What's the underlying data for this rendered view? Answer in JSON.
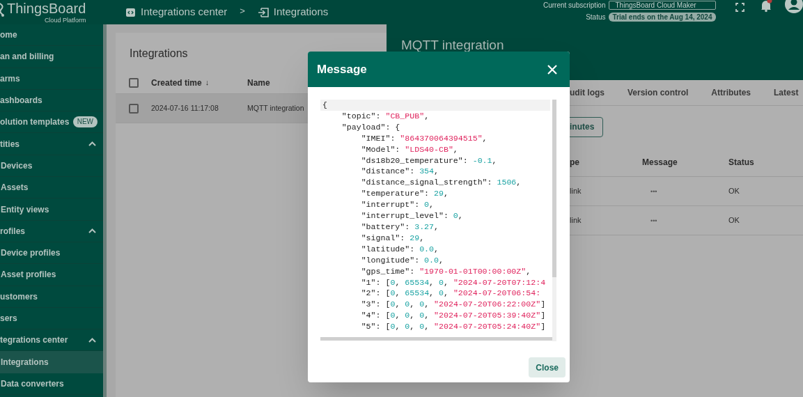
{
  "header": {
    "logo_title": "ThingsBoard",
    "logo_subtitle": "Cloud Platform",
    "breadcrumbs": [
      "Integrations center",
      "Integrations"
    ],
    "breadcrumb_separator": ">",
    "subscription_label": "Current subscription",
    "subscription_value": "ThingsBoard Cloud Maker",
    "status_label": "Status",
    "status_value": "Trial ends on the Aug 14, 2024"
  },
  "sidebar": {
    "items": [
      {
        "kind": "item",
        "label": "ome",
        "selected": false
      },
      {
        "kind": "item",
        "label": "an and billing",
        "selected": false
      },
      {
        "kind": "item",
        "label": "arms",
        "selected": false
      },
      {
        "kind": "item",
        "label": "ashboards",
        "selected": false
      },
      {
        "kind": "item",
        "label": "olution templates",
        "badge": "NEW",
        "selected": false
      },
      {
        "kind": "section",
        "label": "tities",
        "expanded": true,
        "children": [
          {
            "label": "Devices",
            "selected": false
          },
          {
            "label": "Assets",
            "selected": false
          },
          {
            "label": "Entity views",
            "selected": false
          }
        ]
      },
      {
        "kind": "section",
        "label": "rofiles",
        "expanded": true,
        "children": [
          {
            "label": "Device profiles",
            "selected": false
          },
          {
            "label": "Asset profiles",
            "selected": false
          }
        ]
      },
      {
        "kind": "item",
        "label": "ustomers",
        "selected": false
      },
      {
        "kind": "item",
        "label": "sers",
        "selected": false
      },
      {
        "kind": "section",
        "label": "tegrations center",
        "expanded": true,
        "children": [
          {
            "label": "Integrations",
            "selected": true
          },
          {
            "label": "Data converters",
            "selected": false
          }
        ]
      }
    ]
  },
  "integrations_card": {
    "title": "Integrations",
    "all_checked": false,
    "columns": [
      "Created time",
      "Name"
    ],
    "sort_arrow": "↓",
    "rows": [
      {
        "created_time": "2024-07-16 11:17:08",
        "name": "MQTT integration",
        "checked": false,
        "selected": true
      }
    ]
  },
  "details_panel": {
    "title": "MQTT integration",
    "tabs": [
      "udit logs",
      "Version control",
      "Attributes",
      "Latest"
    ],
    "time_button": "inutes",
    "columns": [
      "pe",
      "Message",
      "Status"
    ],
    "rows": [
      {
        "type": "link",
        "message": "•••",
        "status": "OK"
      },
      {
        "type": "link",
        "message": "•••",
        "status": "OK"
      }
    ]
  },
  "dialog": {
    "title": "Message",
    "close_button": "Close",
    "code_lines": [
      {
        "highlighted": true,
        "tokens": [
          {
            "kind": "plain",
            "text": "{"
          }
        ]
      },
      {
        "highlighted": false,
        "tokens": [
          {
            "kind": "plain",
            "text": "    \"topic\": "
          },
          {
            "kind": "string",
            "text": "\"CB_PUB\""
          },
          {
            "kind": "plain",
            "text": ","
          }
        ]
      },
      {
        "highlighted": false,
        "tokens": [
          {
            "kind": "plain",
            "text": "    \"payload\": {"
          }
        ]
      },
      {
        "highlighted": false,
        "tokens": [
          {
            "kind": "plain",
            "text": "        \"IMEI\": "
          },
          {
            "kind": "string",
            "text": "\"864370064394515\""
          },
          {
            "kind": "plain",
            "text": ","
          }
        ]
      },
      {
        "highlighted": false,
        "tokens": [
          {
            "kind": "plain",
            "text": "        \"Model\": "
          },
          {
            "kind": "string",
            "text": "\"LDS40-CB\""
          },
          {
            "kind": "plain",
            "text": ","
          }
        ]
      },
      {
        "highlighted": false,
        "tokens": [
          {
            "kind": "plain",
            "text": "        \"ds18b20_temperature\": "
          },
          {
            "kind": "number",
            "text": "-0.1"
          },
          {
            "kind": "plain",
            "text": ","
          }
        ]
      },
      {
        "highlighted": false,
        "tokens": [
          {
            "kind": "plain",
            "text": "        \"distance\": "
          },
          {
            "kind": "number",
            "text": "354"
          },
          {
            "kind": "plain",
            "text": ","
          }
        ]
      },
      {
        "highlighted": false,
        "tokens": [
          {
            "kind": "plain",
            "text": "        \"distance_signal_strength\": "
          },
          {
            "kind": "number",
            "text": "1506"
          },
          {
            "kind": "plain",
            "text": ","
          }
        ]
      },
      {
        "highlighted": false,
        "tokens": [
          {
            "kind": "plain",
            "text": "        \"temperature\": "
          },
          {
            "kind": "number",
            "text": "29"
          },
          {
            "kind": "plain",
            "text": ","
          }
        ]
      },
      {
        "highlighted": false,
        "tokens": [
          {
            "kind": "plain",
            "text": "        \"interrupt\": "
          },
          {
            "kind": "number",
            "text": "0"
          },
          {
            "kind": "plain",
            "text": ","
          }
        ]
      },
      {
        "highlighted": false,
        "tokens": [
          {
            "kind": "plain",
            "text": "        \"interrupt_level\": "
          },
          {
            "kind": "number",
            "text": "0"
          },
          {
            "kind": "plain",
            "text": ","
          }
        ]
      },
      {
        "highlighted": false,
        "tokens": [
          {
            "kind": "plain",
            "text": "        \"battery\": "
          },
          {
            "kind": "number",
            "text": "3.27"
          },
          {
            "kind": "plain",
            "text": ","
          }
        ]
      },
      {
        "highlighted": false,
        "tokens": [
          {
            "kind": "plain",
            "text": "        \"signal\": "
          },
          {
            "kind": "number",
            "text": "29"
          },
          {
            "kind": "plain",
            "text": ","
          }
        ]
      },
      {
        "highlighted": false,
        "tokens": [
          {
            "kind": "plain",
            "text": "        \"latitude\": "
          },
          {
            "kind": "number",
            "text": "0.0"
          },
          {
            "kind": "plain",
            "text": ","
          }
        ]
      },
      {
        "highlighted": false,
        "tokens": [
          {
            "kind": "plain",
            "text": "        \"longitude\": "
          },
          {
            "kind": "number",
            "text": "0.0"
          },
          {
            "kind": "plain",
            "text": ","
          }
        ]
      },
      {
        "highlighted": false,
        "tokens": [
          {
            "kind": "plain",
            "text": "        \"gps_time\": "
          },
          {
            "kind": "string",
            "text": "\"1970-01-01T00:00:00Z\""
          },
          {
            "kind": "plain",
            "text": ","
          }
        ]
      },
      {
        "highlighted": false,
        "tokens": [
          {
            "kind": "plain",
            "text": "        \"1\": ["
          },
          {
            "kind": "number",
            "text": "0"
          },
          {
            "kind": "plain",
            "text": ", "
          },
          {
            "kind": "number",
            "text": "65534"
          },
          {
            "kind": "plain",
            "text": ", "
          },
          {
            "kind": "number",
            "text": "0"
          },
          {
            "kind": "plain",
            "text": ", "
          },
          {
            "kind": "string",
            "text": "\"2024-07-20T07:12:4"
          }
        ]
      },
      {
        "highlighted": false,
        "tokens": [
          {
            "kind": "plain",
            "text": "        \"2\": ["
          },
          {
            "kind": "number",
            "text": "0"
          },
          {
            "kind": "plain",
            "text": ", "
          },
          {
            "kind": "number",
            "text": "65534"
          },
          {
            "kind": "plain",
            "text": ", "
          },
          {
            "kind": "number",
            "text": "0"
          },
          {
            "kind": "plain",
            "text": ", "
          },
          {
            "kind": "string",
            "text": "\"2024-07-20T06:54:"
          }
        ]
      },
      {
        "highlighted": false,
        "tokens": [
          {
            "kind": "plain",
            "text": "        \"3\": ["
          },
          {
            "kind": "number",
            "text": "0"
          },
          {
            "kind": "plain",
            "text": ", "
          },
          {
            "kind": "number",
            "text": "0"
          },
          {
            "kind": "plain",
            "text": ", "
          },
          {
            "kind": "number",
            "text": "0"
          },
          {
            "kind": "plain",
            "text": ", "
          },
          {
            "kind": "string",
            "text": "\"2024-07-20T06:22:00Z\""
          },
          {
            "kind": "plain",
            "text": "]"
          }
        ]
      },
      {
        "highlighted": false,
        "tokens": [
          {
            "kind": "plain",
            "text": "        \"4\": ["
          },
          {
            "kind": "number",
            "text": "0"
          },
          {
            "kind": "plain",
            "text": ", "
          },
          {
            "kind": "number",
            "text": "0"
          },
          {
            "kind": "plain",
            "text": ", "
          },
          {
            "kind": "number",
            "text": "0"
          },
          {
            "kind": "plain",
            "text": ", "
          },
          {
            "kind": "string",
            "text": "\"2024-07-20T05:39:40Z\""
          },
          {
            "kind": "plain",
            "text": "]"
          }
        ]
      },
      {
        "highlighted": false,
        "tokens": [
          {
            "kind": "plain",
            "text": "        \"5\": ["
          },
          {
            "kind": "number",
            "text": "0"
          },
          {
            "kind": "plain",
            "text": ", "
          },
          {
            "kind": "number",
            "text": "0"
          },
          {
            "kind": "plain",
            "text": ", "
          },
          {
            "kind": "number",
            "text": "0"
          },
          {
            "kind": "plain",
            "text": ", "
          },
          {
            "kind": "string",
            "text": "\"2024-07-20T05:24:40Z\""
          },
          {
            "kind": "plain",
            "text": "]"
          }
        ]
      }
    ]
  }
}
